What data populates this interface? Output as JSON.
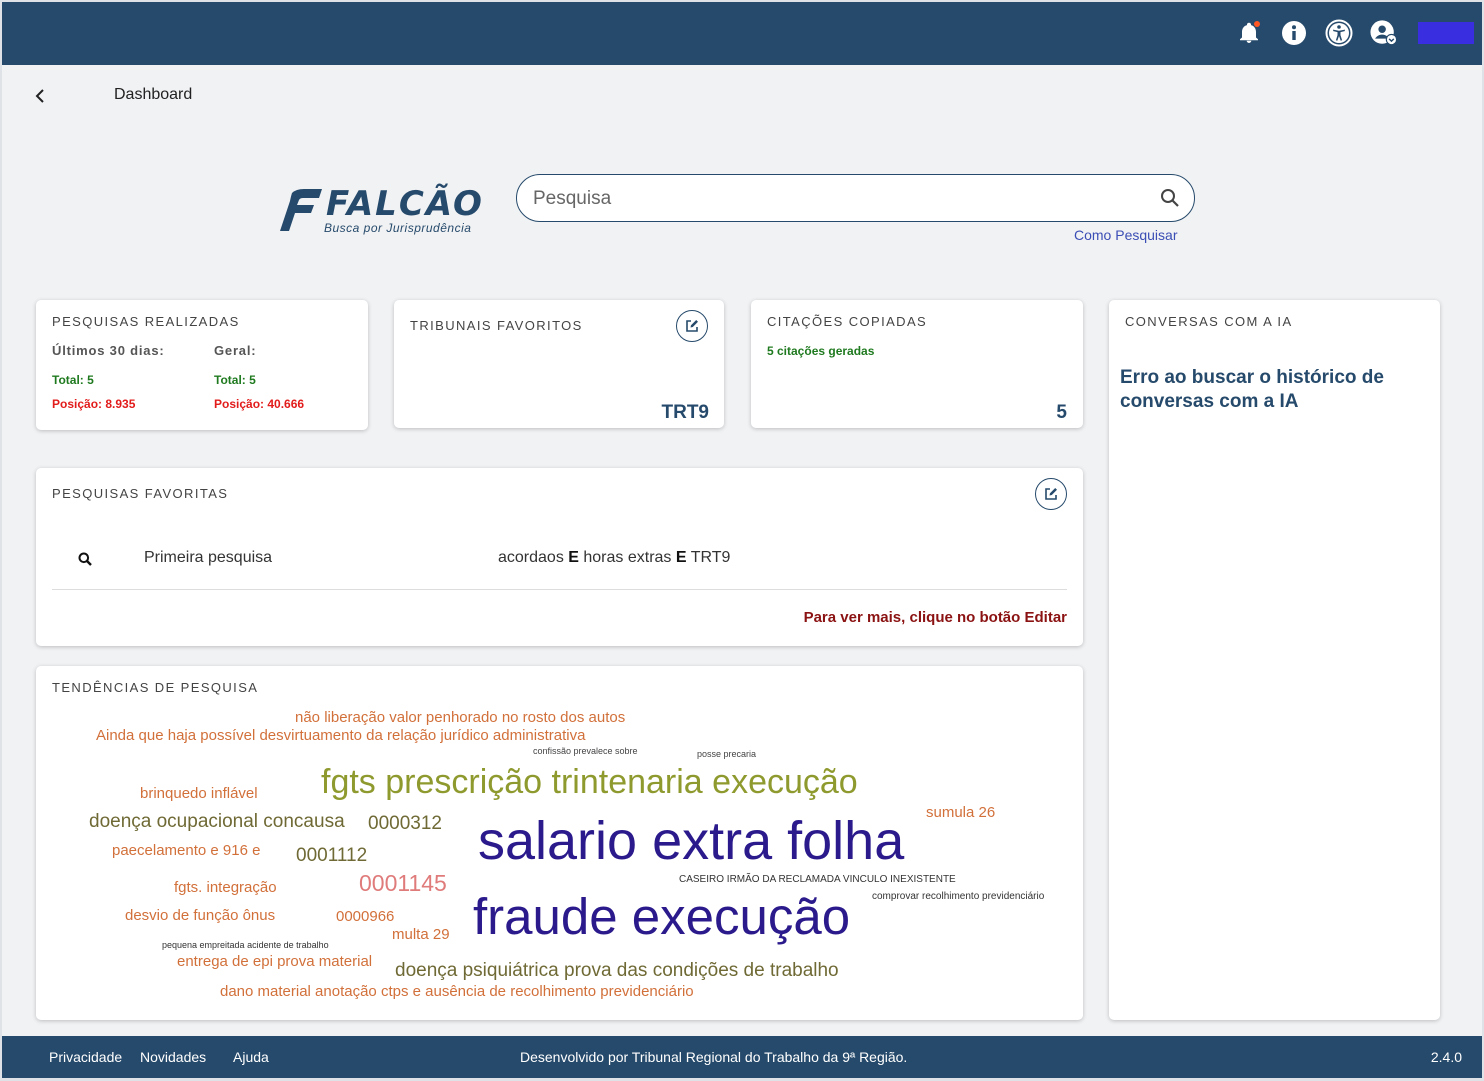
{
  "header": {
    "icons": [
      "bell-icon",
      "info-icon",
      "accessibility-icon",
      "account-icon"
    ]
  },
  "breadcrumb": {
    "title": "Dashboard"
  },
  "logo": {
    "name": "FALCÃO",
    "subtitle": "Busca por Jurisprudência"
  },
  "search": {
    "placeholder": "Pesquisa",
    "help_link": "Como Pesquisar"
  },
  "stats": {
    "title": "PESQUISAS REALIZADAS",
    "last30_label": "Últimos 30 dias:",
    "last30_total": "Total: 5",
    "last30_position": "Posição: 8.935",
    "general_label": "Geral:",
    "general_total": "Total: 5",
    "general_position": "Posição: 40.666"
  },
  "courts": {
    "title": "TRIBUNAIS FAVORITOS",
    "value": "TRT9"
  },
  "citations": {
    "title": "CITAÇÕES COPIADAS",
    "subtitle": "5 citações geradas",
    "value": "5"
  },
  "ai": {
    "title": "CONVERSAS COM A IA",
    "error": "Erro ao buscar o histórico de conversas com a IA"
  },
  "favorites": {
    "title": "PESQUISAS FAVORITAS",
    "items": [
      {
        "name": "Primeira pesquisa",
        "q1": "acordaos ",
        "op1": "E",
        "q2": " horas extras ",
        "op2": "E",
        "q3": " TRT9"
      }
    ],
    "more": "Para ver mais, clique no botão Editar"
  },
  "trends": {
    "title": "TENDÊNCIAS DE PESQUISA",
    "words": [
      "não liberação valor penhorado no rosto dos autos",
      "Ainda que haja possível desvirtuamento da relação jurídico administrativa",
      "confissão prevalece sobre",
      "posse precaria",
      "brinquedo inflável",
      "fgts prescrição trintenaria execução",
      "sumula 26",
      "doença ocupacional concausa",
      "0000312",
      "salario extra folha",
      "paecelamento e 916 e",
      "0001112",
      "fgts. integração",
      "0001145",
      "CASEIRO IRMÃO DA RECLAMADA VINCULO INEXISTENTE",
      "comprovar recolhimento previdenciário",
      "desvio de função ônus",
      "0000966",
      "fraude execução",
      "multa 29",
      "pequena empreitada acidente de trabalho",
      "entrega de epi prova material",
      "doença psiquiátrica prova das condições de trabalho",
      "dano material anotação ctps e ausência de recolhimento previdenciário"
    ]
  },
  "footer": {
    "privacy": "Privacidade",
    "news": "Novidades",
    "help": "Ajuda",
    "credit": "Desenvolvido por Tribunal Regional do Trabalho da 9ª Região.",
    "version": "2.4.0"
  },
  "colors": {
    "primary": "#264a6b",
    "accent_link": "#3b4eb5",
    "green": "#1f7a1f",
    "red": "#e21b1b",
    "dark_red": "#8b1212",
    "word_orange": "#d2703a",
    "word_olive": "#8f9a2e",
    "word_indigo": "#2a1a8c",
    "word_pink": "#e07b7b"
  }
}
